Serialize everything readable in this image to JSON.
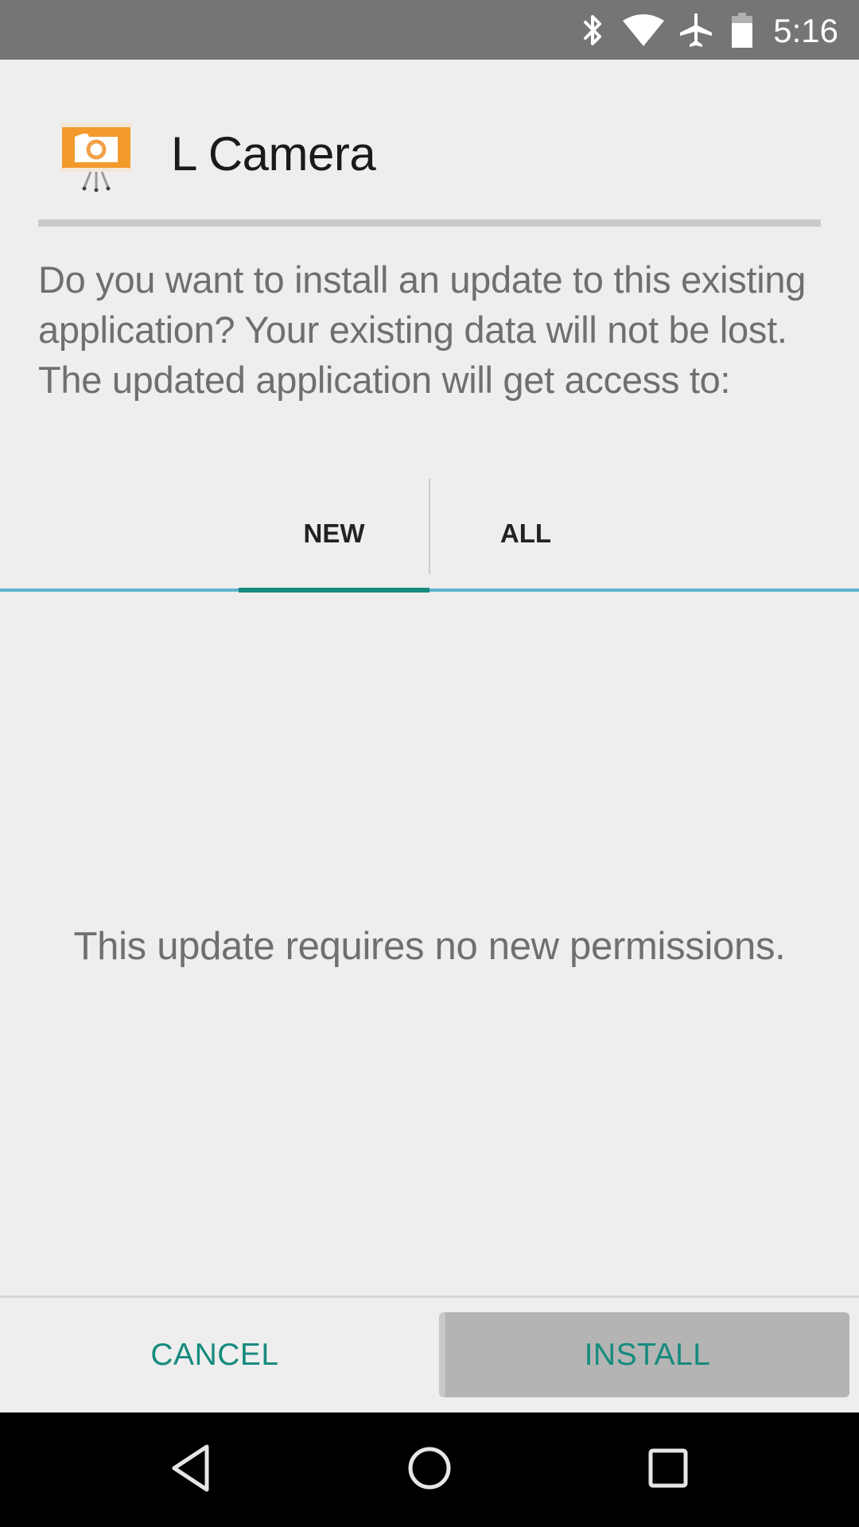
{
  "status_bar": {
    "time": "5:16",
    "icons": [
      "bluetooth-icon",
      "wifi-icon",
      "airplane-mode-icon",
      "battery-icon"
    ],
    "color": "#757575"
  },
  "dialog": {
    "app_name": "L Camera",
    "app_icon": "camera-presentation-icon",
    "message": "Do you want to install an update to this existing application? Your existing data will not be lost. The updated application will get access to:",
    "tabs": [
      {
        "label": "NEW",
        "selected": true
      },
      {
        "label": "ALL",
        "selected": false
      }
    ],
    "permissions_message": "This update requires no new permissions.",
    "buttons": {
      "cancel": "CANCEL",
      "install": "INSTALL"
    },
    "accent_color": "#168b7d"
  },
  "nav_bar": {
    "buttons": [
      "back-icon",
      "home-icon",
      "recents-icon"
    ]
  }
}
